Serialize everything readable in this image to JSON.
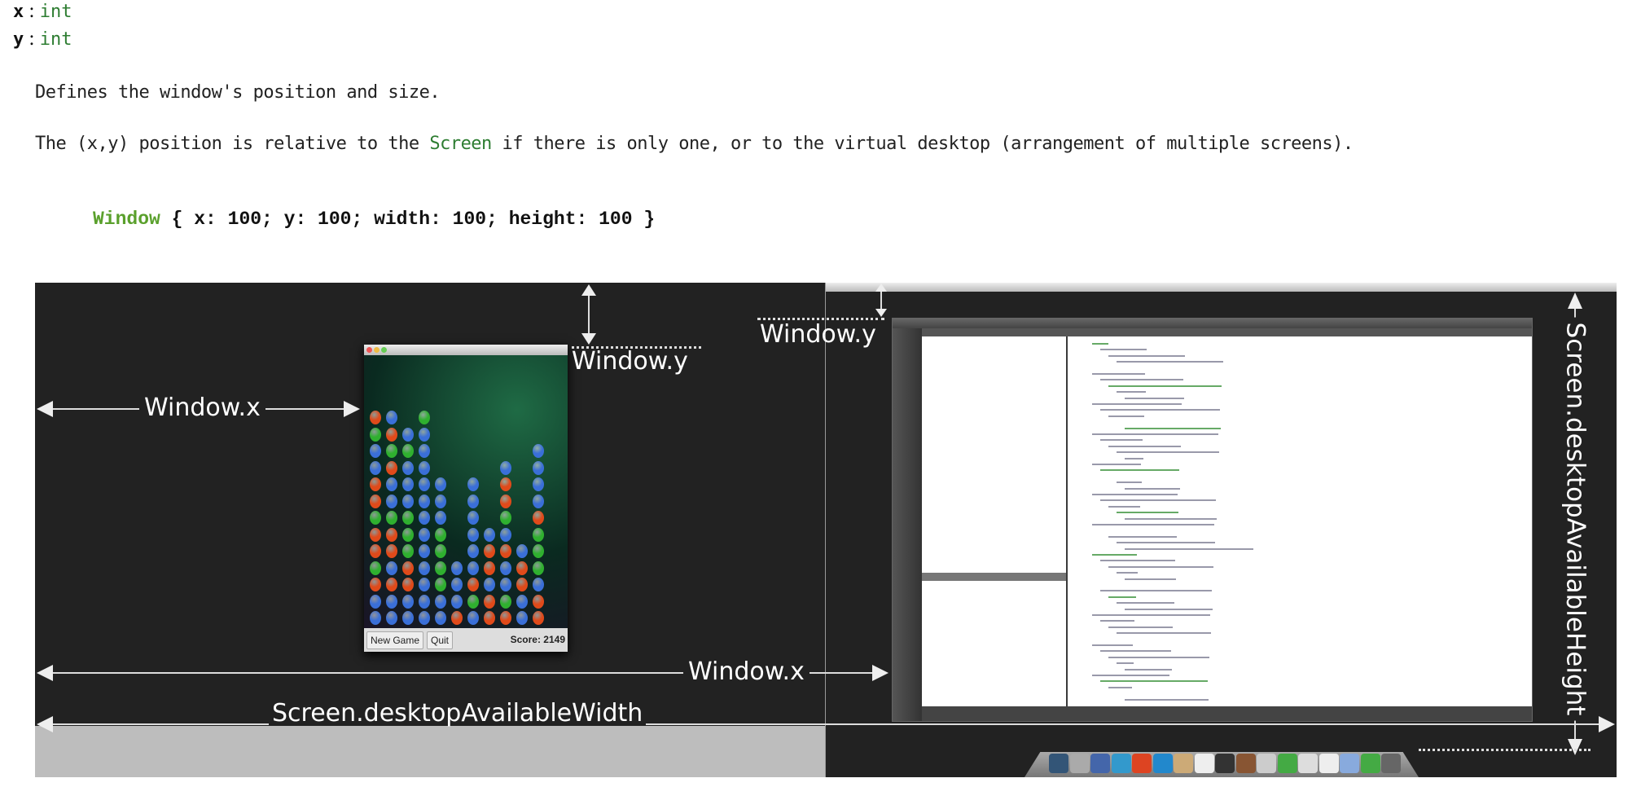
{
  "properties": [
    {
      "name": "x",
      "separator": ":",
      "type": "int"
    },
    {
      "name": "y",
      "separator": ":",
      "type": "int"
    }
  ],
  "description": {
    "line1": "Defines the window's position and size.",
    "line2_pre": "The (x,y) position is relative to the ",
    "line2_link": "Screen",
    "line2_post": " if there is only one, or to the virtual desktop (arrangement of multiple screens)."
  },
  "code": {
    "keyword": "Window",
    "body": " { x: 100; y: 100; width: 100; height: 100 }"
  },
  "diagram": {
    "window_x_label": "Window.x",
    "window_y_label": "Window.y",
    "width_label": "Screen.desktopAvailableWidth",
    "height_label": "Screen.desktopAvailableHeight",
    "game": {
      "new_game": "New Game",
      "quit": "Quit",
      "score": "Score: 2149"
    },
    "colors": {
      "background": "#222222",
      "ball_red": "#e04a1a",
      "ball_blue": "#3a6fd8",
      "ball_green": "#2fb02f"
    }
  }
}
